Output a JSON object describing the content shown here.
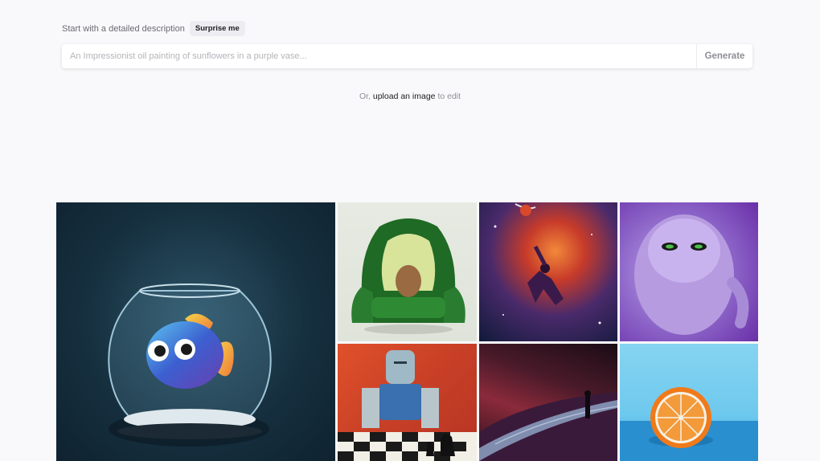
{
  "prompt": {
    "intro_label": "Start with a detailed description",
    "surprise_button": "Surprise me",
    "input_placeholder": "An Impressionist oil painting of sunflowers in a purple vase...",
    "input_value": "",
    "generate_button": "Generate"
  },
  "upload": {
    "prefix": "Or,",
    "link": "upload an image",
    "suffix": "to edit"
  },
  "gallery": {
    "images": [
      {
        "name": "fishbowl-image",
        "icon": "fish-in-bowl"
      },
      {
        "name": "avocado-chair-image",
        "icon": "avocado-armchair"
      },
      {
        "name": "space-dunk-image",
        "icon": "basketball-dunk-in-space"
      },
      {
        "name": "purple-monster-image",
        "icon": "fluffy-purple-monster"
      },
      {
        "name": "robot-chess-image",
        "icon": "robot-playing-chess"
      },
      {
        "name": "desert-figure-image",
        "icon": "figure-on-dunes"
      },
      {
        "name": "orange-image",
        "icon": "halved-orange"
      }
    ]
  },
  "colors": {
    "background": "#f9f9fb",
    "text_primary": "#202123",
    "text_secondary": "#6b6b72",
    "button_bg": "#ececf1"
  }
}
